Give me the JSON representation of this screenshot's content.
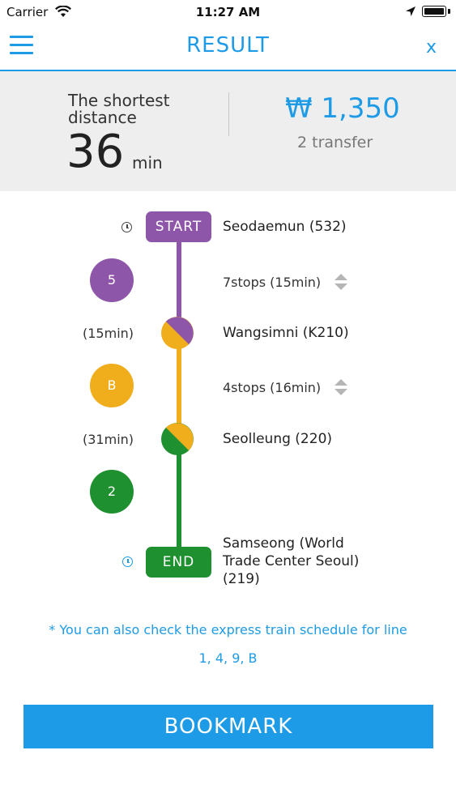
{
  "status_bar": {
    "carrier": "Carrier",
    "time": "11:27 AM"
  },
  "nav": {
    "title": "RESULT",
    "close_label": "X"
  },
  "summary": {
    "label_line1": "The shortest",
    "label_line2": "distance",
    "minutes": "36",
    "minutes_unit": "min",
    "fare": "₩ 1,350",
    "transfers": "2 transfer"
  },
  "route": {
    "start_label": "START",
    "end_label": "END",
    "stations": [
      {
        "name": "Seodaemun (532)",
        "duration": ""
      },
      {
        "name": "Wangsimni (K210)",
        "duration": "(15min)"
      },
      {
        "name": "Seolleung (220)",
        "duration": "(31min)"
      },
      {
        "name_lines": [
          "Samseong (World",
          "Trade Center Seoul)",
          "(219)"
        ],
        "duration": ""
      }
    ],
    "segments": [
      {
        "line": "5",
        "color": "#8e56a8",
        "stops": "7stops (15min)"
      },
      {
        "line": "B",
        "color": "#f0ad1c",
        "stops": "4stops (16min)"
      },
      {
        "line": "2",
        "color": "#1e9030",
        "stops": ""
      }
    ]
  },
  "note": {
    "line1": "* You can also check the express train schedule for line",
    "line2": "1, 4, 9, B"
  },
  "bookmark_label": "BOOKMARK",
  "colors": {
    "accent": "#1e9be6",
    "summary_bg": "#eeeeee"
  }
}
